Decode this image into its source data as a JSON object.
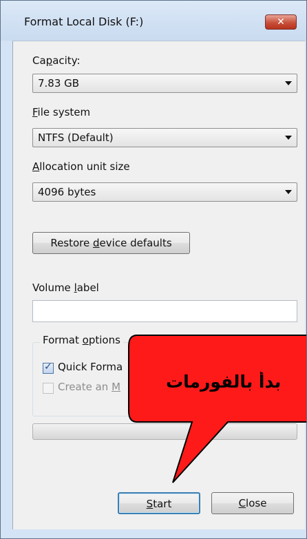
{
  "window": {
    "title": "Format Local Disk (F:)",
    "close_glyph": "✕"
  },
  "capacity": {
    "label_pre": "Ca",
    "label_key": "p",
    "label_post": "acity:",
    "value": "7.83 GB"
  },
  "file_system": {
    "label_key": "F",
    "label_post": "ile system",
    "value": "NTFS (Default)"
  },
  "allocation": {
    "label_key": "A",
    "label_post": "llocation unit size",
    "value": "4096 bytes"
  },
  "restore_button": {
    "label_pre": "Restore ",
    "label_key": "d",
    "label_post": "evice defaults"
  },
  "volume_label": {
    "label_pre": "Volume ",
    "label_key": "l",
    "label_post": "abel",
    "value": ""
  },
  "format_options": {
    "title_pre": "Format ",
    "title_key": "o",
    "title_post": "ptions",
    "quick_format_visible": "Quick Forma",
    "create_msdos_visible_pre": "Create an ",
    "create_msdos_visible_key": "M",
    "quick_format_checked": true,
    "create_msdos_checked": false
  },
  "progress": {
    "value": 0
  },
  "buttons": {
    "start_pre": "",
    "start_key": "S",
    "start_post": "tart",
    "close_pre": "",
    "close_key": "C",
    "close_post": "lose"
  },
  "callout": {
    "text": "بدأ بالفورمات",
    "fill_color": "#ff1a1a",
    "border_color": "#000000"
  }
}
